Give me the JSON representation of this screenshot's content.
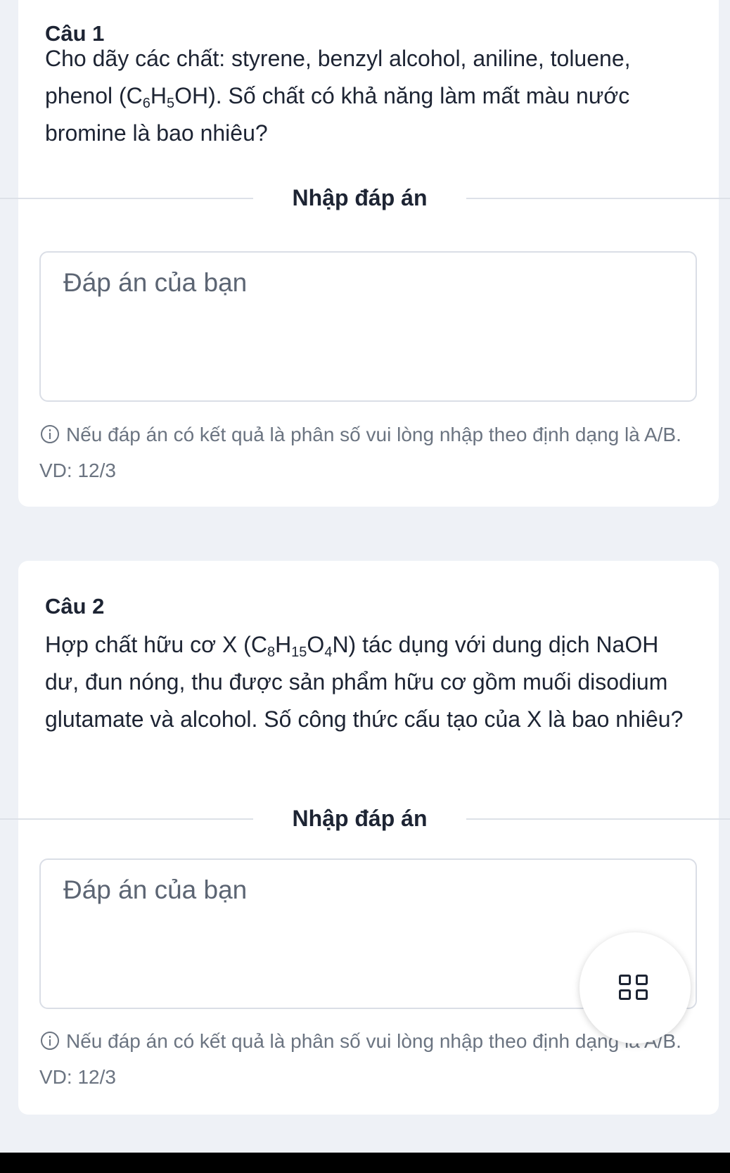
{
  "answer_label": "Nhập đáp án",
  "questions": [
    {
      "title": "Câu 1",
      "text_before": "Cho dãy các chất: styrene, benzyl alcohol, aniline, toluene, phenol (C",
      "formula": [
        {
          "t": "C"
        },
        {
          "sub": "6"
        },
        {
          "t": "H"
        },
        {
          "sub": "5"
        },
        {
          "t": "OH"
        }
      ],
      "text_after": "). Số chất có khả năng làm mất màu nước bromine là bao nhiêu?",
      "answer_placeholder": "Đáp án của bạn",
      "answer_value": "",
      "hint": "Nếu đáp án có kết quả là phân số vui lòng nhập theo định dạng là A/B. VD: 12/3"
    },
    {
      "title": "Câu 2",
      "text_before": "Hợp chất hữu cơ X (",
      "formula": [
        {
          "t": "C"
        },
        {
          "sub": "8"
        },
        {
          "t": "H"
        },
        {
          "sub": "15"
        },
        {
          "t": "O"
        },
        {
          "sub": "4"
        },
        {
          "t": "N"
        }
      ],
      "text_after": ") tác dụng với dung dịch NaOH dư, đun nóng, thu được sản phẩm hữu cơ gồm muối disodium glutamate và alcohol. Số công thức cấu tạo của X là bao nhiêu?",
      "answer_placeholder": "Đáp án của bạn",
      "answer_value": "",
      "hint": "Nếu đáp án có kết quả là phân số vui lòng nhập theo định dạng là A/B. VD: 12/3"
    }
  ],
  "fab": {
    "icon": "grid-icon"
  }
}
